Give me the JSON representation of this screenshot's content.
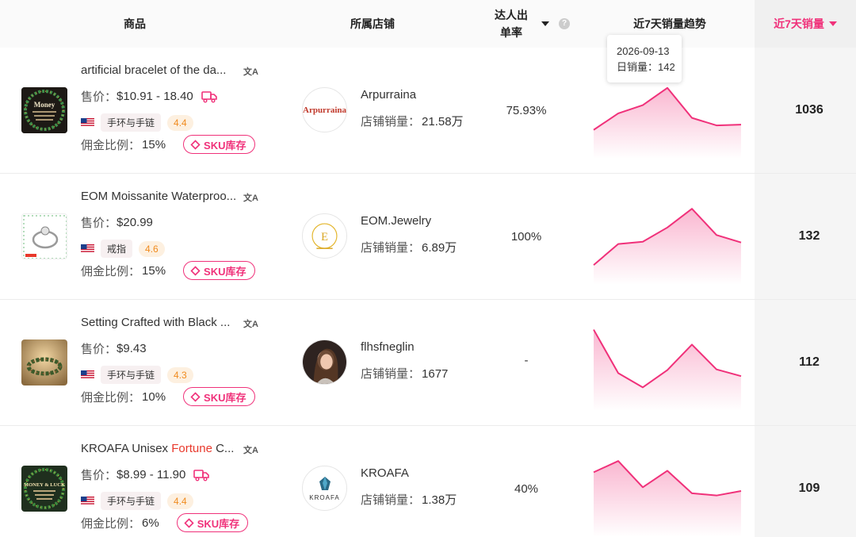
{
  "header": {
    "product": "商品",
    "shop": "所属店铺",
    "rate_line1": "达人出",
    "rate_line2": "单率",
    "help": "?",
    "trend": "近7天销量趋势",
    "sales": "近7天销量"
  },
  "colors": {
    "accent": "#f0317a",
    "highlight": "#e8382b",
    "score": "#f08b1e"
  },
  "tooltip": {
    "date": "2026-09-13",
    "label": "日销量：",
    "value": "142"
  },
  "labels": {
    "price": "售价：",
    "commission": "佣金比例：",
    "sku": "SKU库存",
    "shop_sales": "店铺销量：",
    "translate": "文A"
  },
  "rows": [
    {
      "name": "artificial bracelet of the da...",
      "name_plain": "artificial bracelet of the da...",
      "price": "$10.91 - 18.40",
      "free_shipping": true,
      "country": "US",
      "category": "手环与手链",
      "score": "4.4",
      "commission": "15%",
      "thumb_text": "Money",
      "shop_name": "Arpurraina",
      "shop_logo_text": "Arpurraina",
      "shop_sales": "21.58万",
      "rate": "75.93%",
      "trend": [
        32,
        54,
        65,
        88,
        48,
        38,
        39
      ],
      "sales": "1036"
    },
    {
      "name": "EOM Moissanite Waterproo...",
      "price": "$20.99",
      "free_shipping": false,
      "country": "US",
      "category": "戒指",
      "score": "4.6",
      "commission": "15%",
      "shop_name": "EOM.Jewelry",
      "shop_logo_text": "EOM",
      "shop_sales": "6.89万",
      "rate": "100%",
      "trend": [
        20,
        48,
        51,
        70,
        95,
        60,
        50
      ],
      "sales": "132"
    },
    {
      "name": "Setting Crafted with Black ...",
      "price": "$9.43",
      "free_shipping": false,
      "country": "US",
      "category": "手环与手链",
      "score": "4.3",
      "commission": "10%",
      "shop_name": "flhsfneglin",
      "shop_sales": "1677",
      "rate": "-",
      "trend": [
        102,
        44,
        25,
        48,
        82,
        49,
        40
      ],
      "sales": "112"
    },
    {
      "name_before": "KROAFA Unisex ",
      "name_highlight": "Fortune",
      "name_after": " C...",
      "price": "$8.99 - 11.90",
      "free_shipping": true,
      "country": "US",
      "category": "手环与手链",
      "score": "4.4",
      "commission": "6%",
      "thumb_text": "MONEY & LUCK",
      "shop_name": "KROAFA",
      "shop_logo_text": "KROAFA",
      "shop_sales": "1.38万",
      "rate": "40%",
      "trend": [
        80,
        95,
        60,
        82,
        52,
        49,
        55
      ],
      "sales": "109"
    }
  ]
}
